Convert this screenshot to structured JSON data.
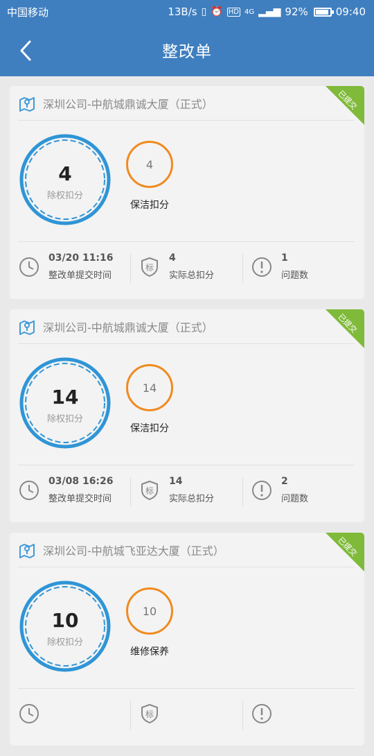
{
  "status_bar": {
    "carrier": "中国移动",
    "speed": "13B/s",
    "hd": "HD",
    "network": "4G",
    "battery": "92%",
    "battery_level": 0.92,
    "time": "09:40"
  },
  "nav": {
    "title": "整改单"
  },
  "colors": {
    "accent": "#3f7fc0",
    "ring_blue": "#2f95d6",
    "ring_orange": "#f08a1e",
    "ribbon": "#7fba3a"
  },
  "cards": [
    {
      "title": "深圳公司-中航城鼎诚大厦（正式）",
      "badge": "已提交",
      "score": "4",
      "score_label": "除权扣分",
      "sub_score": "4",
      "sub_label": "保洁扣分",
      "time_value": "03/20 11:16",
      "time_label": "整改单提交时间",
      "deduct_value": "4",
      "deduct_label": "实际总扣分",
      "issues_value": "1",
      "issues_label": "问题数"
    },
    {
      "title": "深圳公司-中航城鼎诚大厦（正式）",
      "badge": "已提交",
      "score": "14",
      "score_label": "除权扣分",
      "sub_score": "14",
      "sub_label": "保洁扣分",
      "time_value": "03/08 16:26",
      "time_label": "整改单提交时间",
      "deduct_value": "14",
      "deduct_label": "实际总扣分",
      "issues_value": "2",
      "issues_label": "问题数"
    },
    {
      "title": "深圳公司-中航城飞亚达大厦（正式）",
      "badge": "已提交",
      "score": "10",
      "score_label": "除权扣分",
      "sub_score": "10",
      "sub_label": "维修保养",
      "time_value": "",
      "time_label": "",
      "deduct_value": "",
      "deduct_label": "",
      "issues_value": "",
      "issues_label": ""
    }
  ]
}
